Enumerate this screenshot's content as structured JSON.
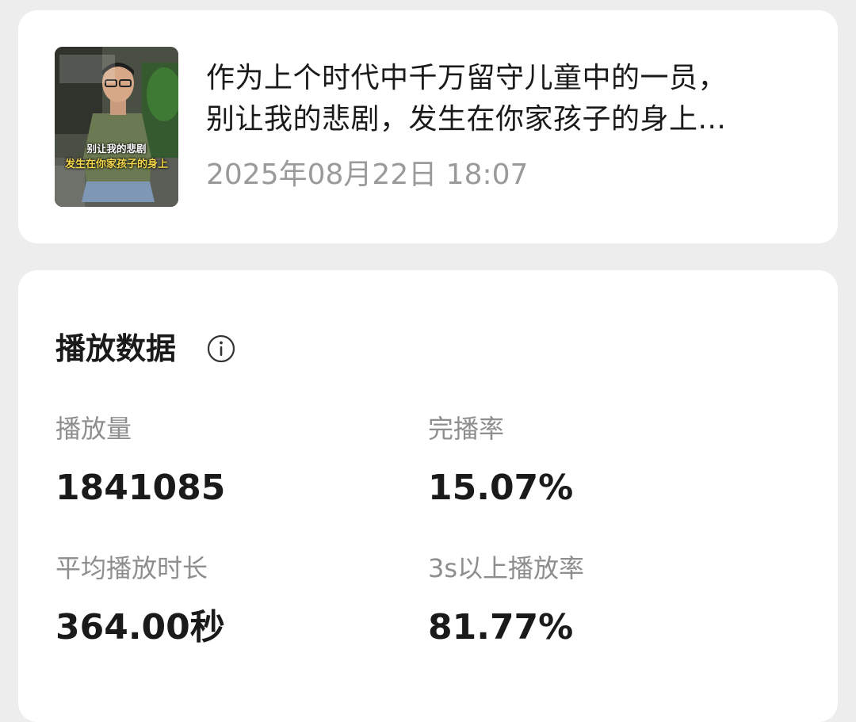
{
  "video": {
    "title_line1": "作为上个时代中千万留守儿童中的一员，",
    "title_line2": "别让我的悲剧，发生在你家孩子的身上...",
    "date": "2025年08月22日 18:07",
    "thumbnail": {
      "caption_line1": "别让我的悲剧",
      "caption_line2": "发生在你家孩子的身上"
    }
  },
  "stats": {
    "title": "播放数据",
    "info_icon": "info-circle-icon",
    "metrics": [
      {
        "label": "播放量",
        "value": "1841085"
      },
      {
        "label": "完播率",
        "value": "15.07%"
      },
      {
        "label": "平均播放时长",
        "value": "364.00秒"
      },
      {
        "label": "3s以上播放率",
        "value": "81.77%"
      }
    ]
  }
}
